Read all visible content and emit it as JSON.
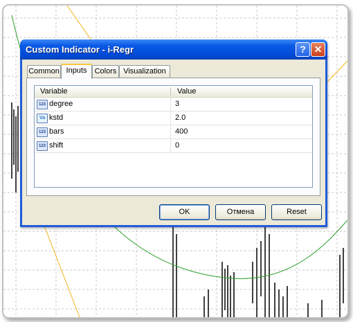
{
  "window": {
    "title": "Custom Indicator - i-Regr",
    "help_glyph": "?",
    "close_glyph": "✕"
  },
  "tabs": [
    {
      "label": "Common"
    },
    {
      "label": "Inputs",
      "active": true
    },
    {
      "label": "Colors"
    },
    {
      "label": "Visualization"
    }
  ],
  "table": {
    "col_variable": "Variable",
    "col_value": "Value",
    "rows": [
      {
        "icon": "123",
        "icon_name": "integer-type-icon",
        "name": "degree",
        "value": "3"
      },
      {
        "icon": "Va",
        "icon_name": "double-type-icon",
        "name": "kstd",
        "value": "2.0"
      },
      {
        "icon": "123",
        "icon_name": "integer-type-icon",
        "name": "bars",
        "value": "400"
      },
      {
        "icon": "123",
        "icon_name": "integer-type-icon",
        "name": "shift",
        "value": "0"
      }
    ]
  },
  "buttons": {
    "ok": "OK",
    "cancel": "Отмена",
    "reset": "Reset"
  },
  "colors": {
    "titlebar": "#0a5ae5",
    "regression_line": "#2ca02c",
    "channel_line": "#f2b51a",
    "bars": "#000000",
    "grid": "#c8c8c8"
  }
}
